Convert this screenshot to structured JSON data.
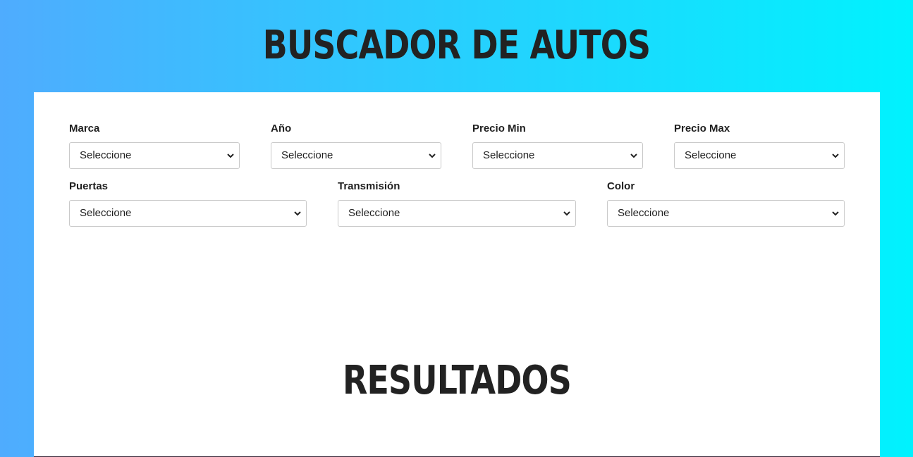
{
  "header": {
    "title": "Buscador de Autos"
  },
  "filters": {
    "row1": [
      {
        "id": "marca",
        "label": "Marca",
        "value": "Seleccione"
      },
      {
        "id": "year",
        "label": "Año",
        "value": "Seleccione"
      },
      {
        "id": "precio-min",
        "label": "Precio Min",
        "value": "Seleccione"
      },
      {
        "id": "precio-max",
        "label": "Precio Max",
        "value": "Seleccione"
      }
    ],
    "row2": [
      {
        "id": "puertas",
        "label": "Puertas",
        "value": "Seleccione"
      },
      {
        "id": "transmision",
        "label": "Transmisión",
        "value": "Seleccione"
      },
      {
        "id": "color",
        "label": "Color",
        "value": "Seleccione"
      }
    ]
  },
  "results": {
    "title": "Resultados"
  },
  "icons": {
    "select_arrow": "chevron-down-icon"
  },
  "colors": {
    "gradient_start": "#4facfe",
    "gradient_end": "#00f2fe",
    "panel": "#ffffff",
    "text": "#1f1f1f"
  }
}
